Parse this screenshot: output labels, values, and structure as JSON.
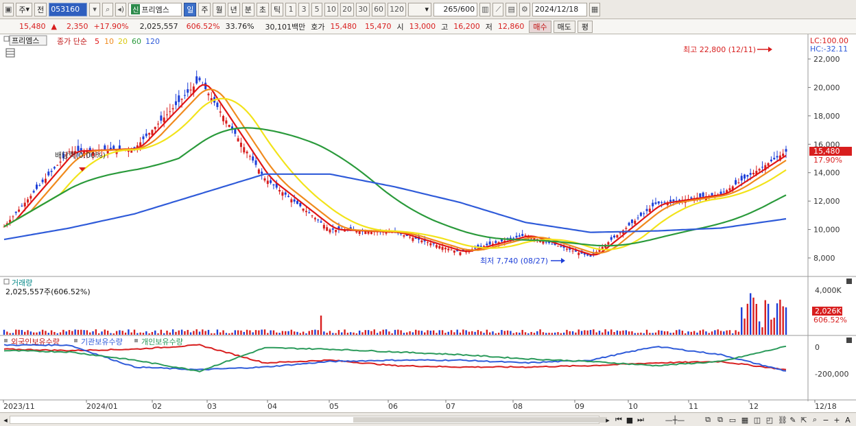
{
  "toolbar": {
    "market_label": "주",
    "prev_label": "전",
    "code": "053160",
    "badge": "신",
    "name": "프리엠스",
    "periods": [
      "일",
      "주",
      "월",
      "년",
      "분",
      "초",
      "틱"
    ],
    "active_period": "일",
    "intervals": [
      "1",
      "3",
      "5",
      "10",
      "20",
      "30",
      "60",
      "120"
    ],
    "count": "265",
    "count_max": "/600",
    "date": "2024/12/18"
  },
  "quote": {
    "price": "15,480",
    "arrow": "▲",
    "change": "2,350",
    "change_pct": "+17.90%",
    "volume": "2,025,557",
    "vol_ratio": "606.52%",
    "turnover": "33.76%",
    "amount": "30,101백만",
    "ask_label": "호가",
    "ask": "15,480",
    "bid": "15,470",
    "open_label": "시",
    "open": "13,000",
    "high_label": "고",
    "high": "16,200",
    "low_label": "저",
    "low": "12,860",
    "buy_label": "매수",
    "sell_label": "매도",
    "eval_label": "평"
  },
  "price_pane": {
    "name_tag": "프리엠스",
    "legend_title": "종가 단순",
    "ma_labels": [
      "5",
      "10",
      "20",
      "60",
      "120"
    ],
    "ma_colors": [
      "#e01515",
      "#f08a1d",
      "#f2e31a",
      "#2a9a3b",
      "#2f5bd9"
    ],
    "lc": "LC:100.00",
    "hc": "HC:-32.11",
    "y_ticks": [
      "22,000",
      "20,000",
      "18,000",
      "16,000",
      "14,000",
      "12,000",
      "10,000",
      "8,000"
    ],
    "last_price_tag": "15,480",
    "last_pct_tag": "17.90%",
    "high_note": "최고 22,800 (12/11)",
    "low_note": "최저 7,740 (08/27)",
    "dividend_note": "배당락(0.00%)"
  },
  "volume_pane": {
    "title": "거래량",
    "subtitle": "2,025,557주(606.52%)",
    "y_tick": "4,000K",
    "tag_value": "2,026K",
    "tag_pct": "606.52%"
  },
  "holder_pane": {
    "series_labels": [
      "외국인보유수량",
      "기관보유수량",
      "개인보유수량"
    ],
    "series_colors": [
      "#d81e1e",
      "#2f5bd9",
      "#2a9a5a"
    ],
    "y_ticks": [
      "0",
      "-200,000"
    ]
  },
  "x_axis": {
    "labels": [
      "2023/11",
      "2024/01",
      "02",
      "03",
      "04",
      "05",
      "06",
      "07",
      "08",
      "09",
      "10",
      "11",
      "12",
      "12/18"
    ]
  },
  "chart_data": {
    "type": "line",
    "title": "",
    "xlabel": "",
    "ylabel": "",
    "x": [
      "2023/11",
      "2024/01",
      "02",
      "03",
      "04",
      "05",
      "06",
      "07",
      "08",
      "09",
      "10",
      "11",
      "12"
    ],
    "ylim": [
      7000,
      22800
    ],
    "series": [
      {
        "name": "5",
        "values": [
          10200,
          15500,
          15700,
          20500,
          13600,
          10000,
          9800,
          8400,
          9600,
          8100,
          11800,
          12500,
          15480
        ]
      },
      {
        "name": "120",
        "values": [
          9300,
          10100,
          11100,
          12500,
          13900,
          13900,
          13000,
          11900,
          10500,
          9800,
          9900,
          10100,
          10750
        ]
      }
    ]
  }
}
